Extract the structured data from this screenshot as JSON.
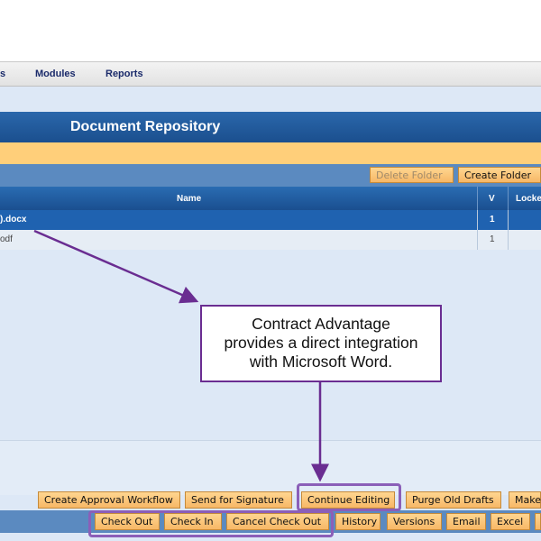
{
  "menu": {
    "fragment": "s",
    "modules": "Modules",
    "reports": "Reports"
  },
  "title": "Document Repository",
  "toolbar": {
    "delete_folder": "Delete Folder",
    "create_folder": "Create Folder"
  },
  "grid": {
    "headers": {
      "name": "Name",
      "version": "V",
      "locked": "Locke"
    },
    "rows": [
      {
        "name": ").docx",
        "version": "1",
        "selected": true
      },
      {
        "name": "odf",
        "version": "1",
        "selected": false
      }
    ]
  },
  "callout": {
    "line1": "Contract Advantage",
    "line2": "provides a direct integration",
    "line3": "with Microsoft Word."
  },
  "actions_row1": {
    "create_approval": "Create Approval Workflow",
    "send_signature": "Send for Signature",
    "continue_editing": "Continue Editing",
    "purge_drafts": "Purge Old Drafts",
    "make": "Make"
  },
  "actions_row2": {
    "check_out": "Check Out",
    "check_in": "Check In",
    "cancel_check_out": "Cancel Check Out",
    "history": "History",
    "versions": "Versions",
    "email": "Email",
    "excel": "Excel"
  },
  "colors": {
    "accent": "#1f62b0",
    "button": "#f7b766",
    "highlight": "#8b5fb8",
    "callout_border": "#6a2d91"
  }
}
